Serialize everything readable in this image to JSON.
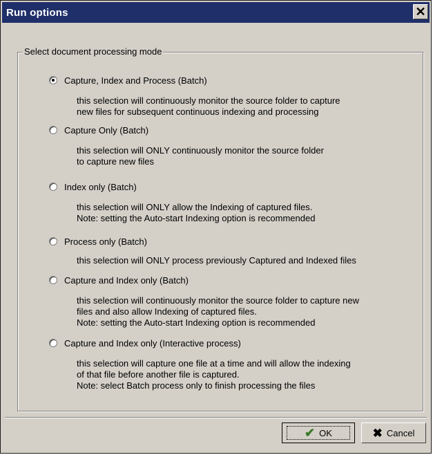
{
  "window": {
    "title": "Run options",
    "close_glyph": "✕"
  },
  "group": {
    "legend": "Select document processing mode"
  },
  "options": [
    {
      "label": "Capture, Index and Process (Batch)",
      "selected": true,
      "desc": [
        "this selection will continuously monitor the source folder to capture",
        "new files for subsequent continuous indexing and processing"
      ]
    },
    {
      "label": "Capture Only (Batch)",
      "selected": false,
      "desc": [
        "this selection will ONLY continuously monitor the source folder",
        "to capture new files"
      ]
    },
    {
      "label": "Index only (Batch)",
      "selected": false,
      "desc": [
        "this selection will ONLY allow the Indexing of captured files.",
        "Note: setting the Auto-start Indexing option is recommended"
      ]
    },
    {
      "label": "Process only (Batch)",
      "selected": false,
      "desc": [
        "this selection will ONLY process previously Captured and Indexed files"
      ]
    },
    {
      "label": "Capture and Index only (Batch)",
      "selected": false,
      "desc": [
        "this selection will continuously monitor the source folder to capture new",
        "files and also allow Indexing of captured files.",
        "Note: setting the Auto-start Indexing option is recommended"
      ]
    },
    {
      "label": "Capture and Index only (Interactive process)",
      "selected": false,
      "desc": [
        "this selection will capture one file at a time and will allow the indexing",
        "of that file before another file is captured.",
        "Note: select Batch process only to finish processing the files"
      ]
    }
  ],
  "buttons": {
    "ok_label": "OK",
    "ok_icon": "check-icon",
    "cancel_label": "Cancel",
    "cancel_icon": "x-icon"
  },
  "colors": {
    "titlebar": "#1f2f6a",
    "dialog_bg": "#d4d0c8",
    "ok_check": "#3a7a2a"
  }
}
